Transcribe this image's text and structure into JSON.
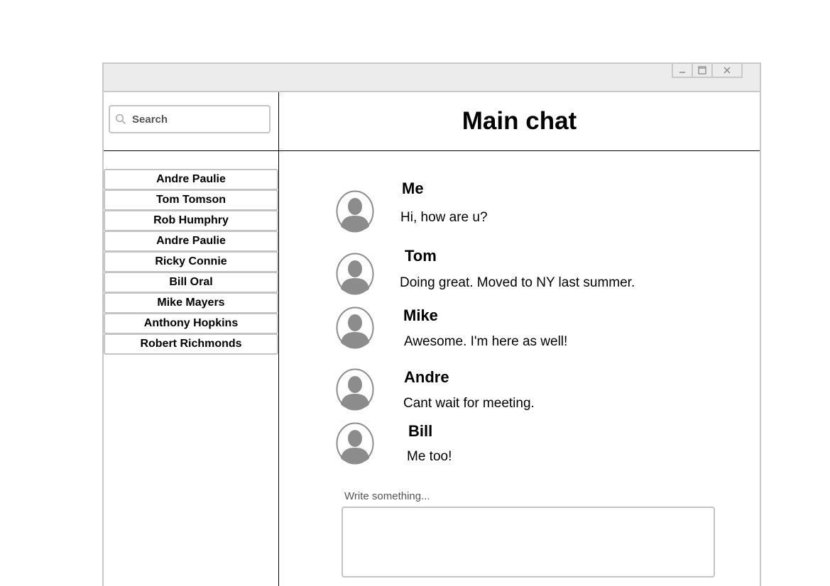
{
  "window": {
    "controls": {
      "minimize": "–",
      "maximize": "☐",
      "close": "✕"
    }
  },
  "sidebar": {
    "search": {
      "placeholder": "Search",
      "icon": "search-icon"
    },
    "contacts": [
      "Andre Paulie",
      "Tom Tomson",
      "Rob Humphry",
      "Andre Paulie",
      "Ricky Connie",
      "Bill Oral",
      "Mike Mayers",
      "Anthony Hopkins",
      "Robert Richmonds"
    ]
  },
  "chat": {
    "title": "Main chat",
    "messages": [
      {
        "sender": "Me",
        "text": "Hi, how are u?"
      },
      {
        "sender": "Tom",
        "text": "Doing great. Moved to NY last summer."
      },
      {
        "sender": "Mike",
        "text": "Awesome. I'm here as well!"
      },
      {
        "sender": "Andre",
        "text": "Cant wait for meeting."
      },
      {
        "sender": "Bill",
        "text": "Me too!"
      }
    ],
    "compose": {
      "label": "Write something...",
      "value": ""
    }
  },
  "colors": {
    "border": "#c4c4c4",
    "titlebar": "#ececec",
    "avatar": "#8c8c8c"
  }
}
